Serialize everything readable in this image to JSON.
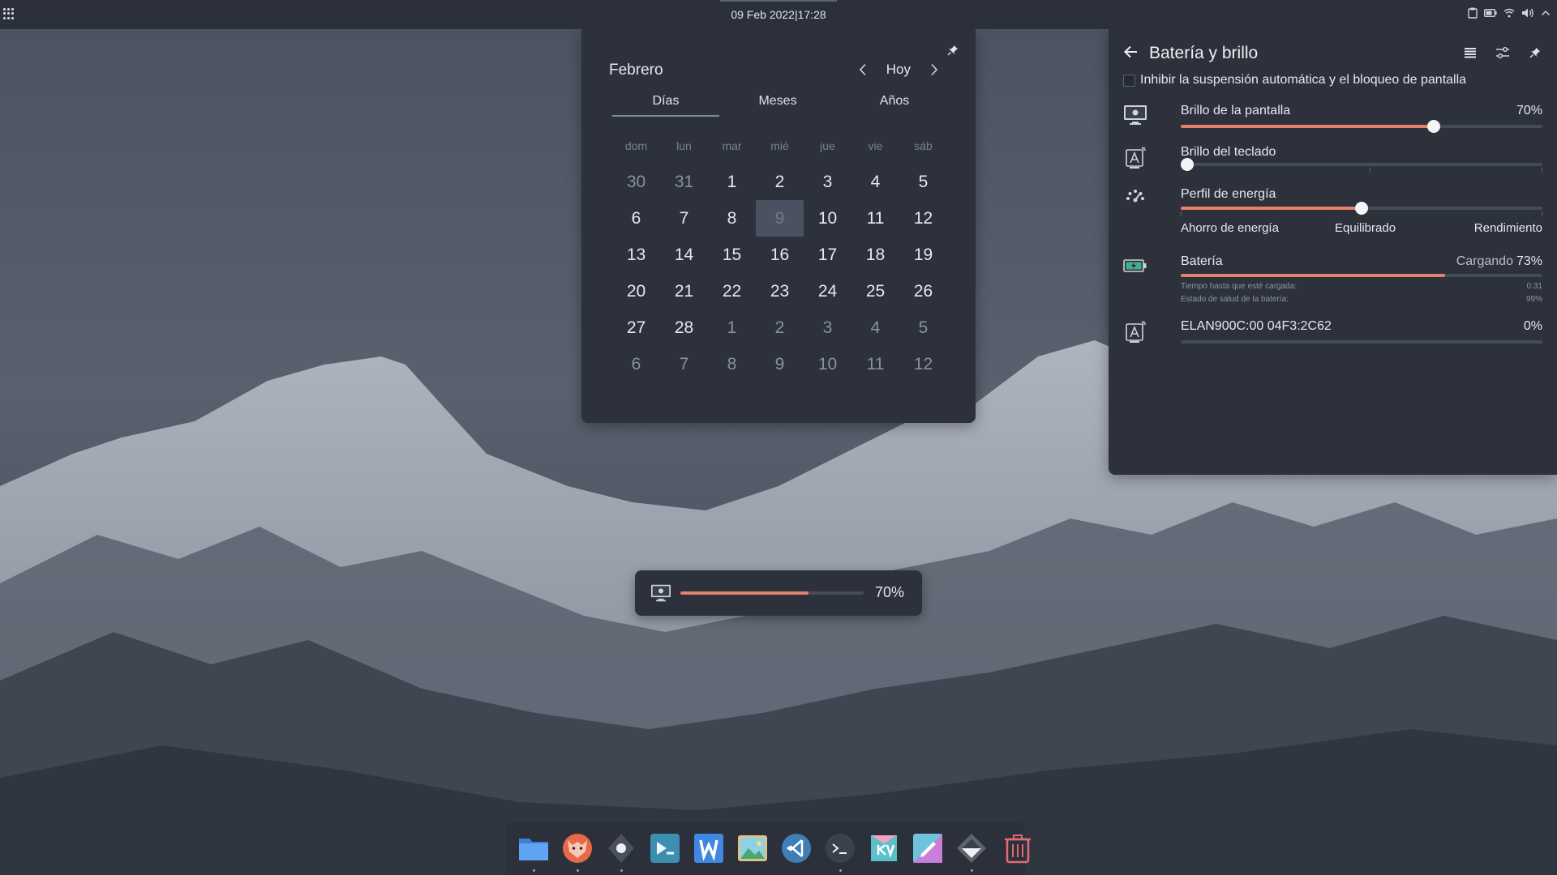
{
  "top_panel": {
    "datetime": "09 Feb 2022|17:28"
  },
  "calendar": {
    "month": "Febrero",
    "today_label": "Hoy",
    "tabs": [
      "Días",
      "Meses",
      "Años"
    ],
    "active_tab": "Días",
    "weekdays": [
      "dom",
      "lun",
      "mar",
      "mié",
      "jue",
      "vie",
      "sáb"
    ],
    "days": [
      {
        "n": "30",
        "other": true
      },
      {
        "n": "31",
        "other": true
      },
      {
        "n": "1"
      },
      {
        "n": "2"
      },
      {
        "n": "3"
      },
      {
        "n": "4"
      },
      {
        "n": "5"
      },
      {
        "n": "6"
      },
      {
        "n": "7"
      },
      {
        "n": "8"
      },
      {
        "n": "9",
        "today": true
      },
      {
        "n": "10"
      },
      {
        "n": "11"
      },
      {
        "n": "12"
      },
      {
        "n": "13"
      },
      {
        "n": "14"
      },
      {
        "n": "15"
      },
      {
        "n": "16"
      },
      {
        "n": "17"
      },
      {
        "n": "18"
      },
      {
        "n": "19"
      },
      {
        "n": "20"
      },
      {
        "n": "21"
      },
      {
        "n": "22"
      },
      {
        "n": "23"
      },
      {
        "n": "24"
      },
      {
        "n": "25"
      },
      {
        "n": "26"
      },
      {
        "n": "27"
      },
      {
        "n": "28"
      },
      {
        "n": "1",
        "other": true
      },
      {
        "n": "2",
        "other": true
      },
      {
        "n": "3",
        "other": true
      },
      {
        "n": "4",
        "other": true
      },
      {
        "n": "5",
        "other": true
      },
      {
        "n": "6",
        "other": true
      },
      {
        "n": "7",
        "other": true
      },
      {
        "n": "8",
        "other": true
      },
      {
        "n": "9",
        "other": true
      },
      {
        "n": "10",
        "other": true
      },
      {
        "n": "11",
        "other": true
      },
      {
        "n": "12",
        "other": true
      }
    ]
  },
  "battery_panel": {
    "title": "Batería y brillo",
    "inhibit_label": "Inhibir la suspensión automática y el bloqueo de pantalla",
    "inhibit_checked": false,
    "screen_brightness": {
      "label": "Brillo de la pantalla",
      "value_text": "70%",
      "level": 0.7
    },
    "keyboard_brightness": {
      "label": "Brillo del teclado",
      "level": 0.0
    },
    "energy_profile": {
      "label": "Perfil de energía",
      "options": [
        "Ahorro de energía",
        "Equilibrado",
        "Rendimiento"
      ],
      "selected": "Equilibrado",
      "level": 0.5
    },
    "battery": {
      "label": "Batería",
      "status": "Cargando",
      "value_text": "73%",
      "level": 0.73,
      "details": [
        {
          "label": "Tiempo hasta que esté cargada:",
          "value": "0:31"
        },
        {
          "label": "Estado de salud de la batería:",
          "value": "99%"
        }
      ]
    },
    "device": {
      "label": "ELAN900C:00 04F3:2C62",
      "value_text": "0%",
      "level": 0.0
    }
  },
  "osd": {
    "value_text": "70%",
    "level": 0.7
  },
  "dock": {
    "items": [
      {
        "name": "file-manager-icon",
        "running": true
      },
      {
        "name": "firefox-icon",
        "running": true
      },
      {
        "name": "settings-icon",
        "running": true
      },
      {
        "name": "discover-icon",
        "running": false
      },
      {
        "name": "writer-icon",
        "running": false
      },
      {
        "name": "image-viewer-icon",
        "running": false
      },
      {
        "name": "vscode-icon",
        "running": false
      },
      {
        "name": "terminal-icon",
        "running": true
      },
      {
        "name": "kvantum-icon",
        "running": false
      },
      {
        "name": "kate-icon",
        "running": false
      },
      {
        "name": "git-icon",
        "running": true
      },
      {
        "name": "trash-icon",
        "running": false
      }
    ]
  },
  "colors": {
    "panel_bg": "#2c313c",
    "accent": "#e3816a",
    "track": "#454c59"
  }
}
